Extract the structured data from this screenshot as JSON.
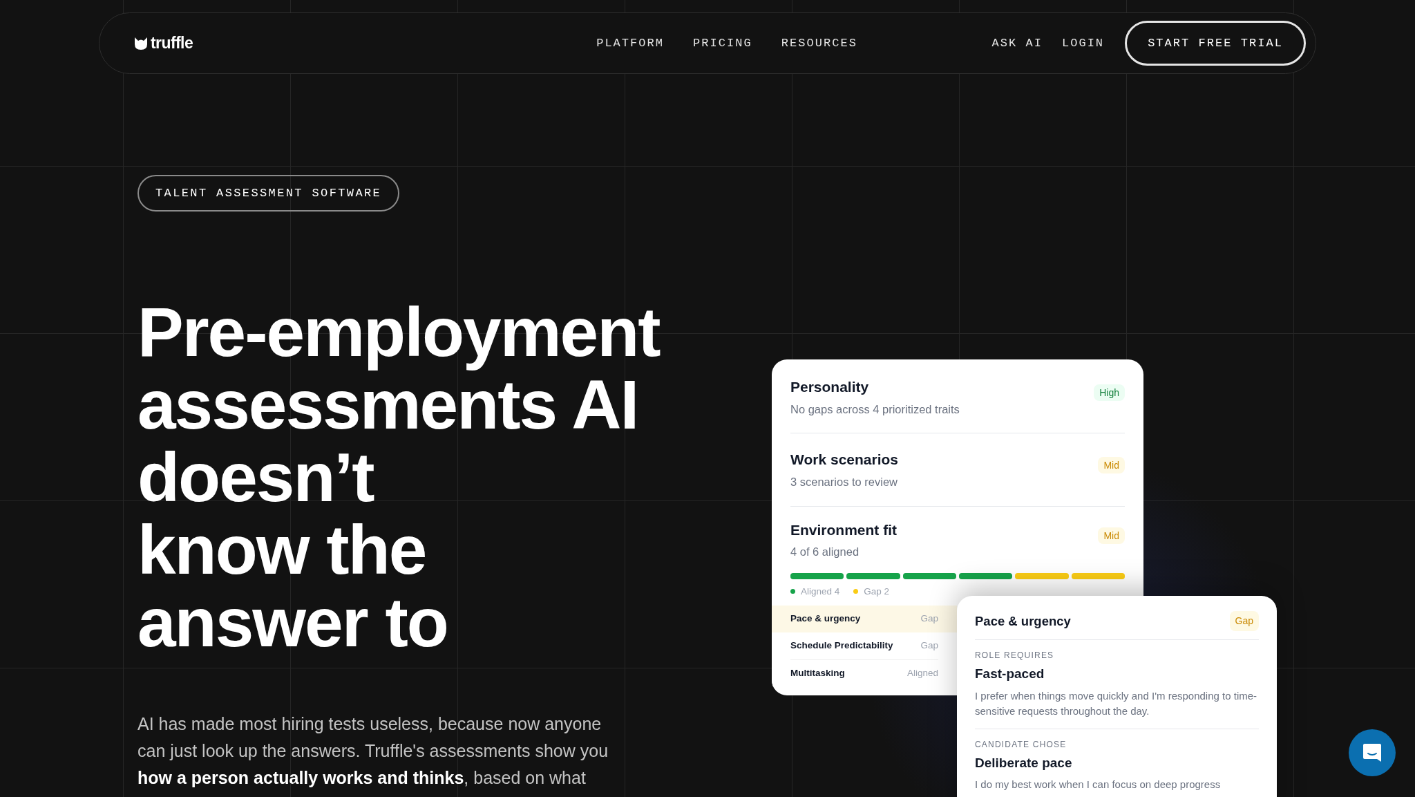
{
  "nav": {
    "logo": "truffle",
    "links": [
      "PLATFORM",
      "PRICING",
      "RESOURCES"
    ],
    "actions": [
      "ASK AI",
      "LOGIN"
    ],
    "cta": "START FREE TRIAL"
  },
  "hero": {
    "badge": "TALENT ASSESSMENT SOFTWARE",
    "headline_lines": [
      "Pre-employment",
      "assessments AI",
      "doesn’t",
      "know the",
      "answer to"
    ],
    "paragraph": "AI has made most hiring tests useless, because now anyone can just look up the answers. Truffle's assessments show you **how a person actually works and thinks**, based on what"
  },
  "summary_card": {
    "sections": [
      {
        "title": "Personality",
        "subtitle": "No gaps across 4 prioritized traits",
        "rating": "High",
        "kind": "high"
      },
      {
        "title": "Work scenarios",
        "subtitle": "3 scenarios to review",
        "rating": "Mid",
        "kind": "mid"
      },
      {
        "title": "Environment fit",
        "subtitle": "4 of 6 aligned",
        "rating": "Mid",
        "kind": "mid"
      }
    ],
    "segments": [
      {
        "color": "#16a34a"
      },
      {
        "color": "#16a34a"
      },
      {
        "color": "#16a34a"
      },
      {
        "color": "#16a34a"
      },
      {
        "color": "#facc15"
      },
      {
        "color": "#facc15"
      }
    ],
    "legend": [
      {
        "label": "Aligned 4",
        "color": "#16a34a"
      },
      {
        "label": "Gap 2",
        "color": "#facc15"
      }
    ],
    "traits": [
      {
        "name": "Pace & urgency",
        "status": "Gap",
        "selected": true
      },
      {
        "name": "Schedule Predictability",
        "status": "Gap",
        "selected": false
      },
      {
        "name": "Multitasking",
        "status": "Aligned",
        "selected": false
      }
    ]
  },
  "detail_card": {
    "title": "Pace & urgency",
    "rating": "Gap",
    "kind": "mid",
    "blocks": [
      {
        "label": "ROLE REQUIRES",
        "title": "Fast-paced",
        "text": "I prefer when things move quickly and I'm responding to time-sensitive requests throughout the day."
      },
      {
        "label": "CANDIDATE CHOSE",
        "title": "Deliberate pace",
        "text": "I do my best work when I can focus on deep progress"
      }
    ]
  }
}
